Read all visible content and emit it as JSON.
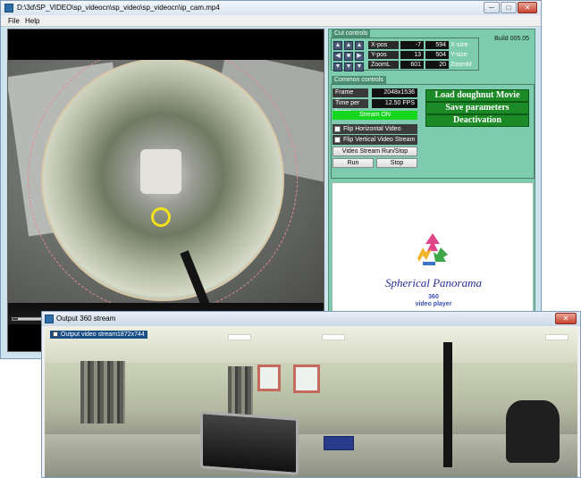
{
  "main_window": {
    "title": "D:\\3d\\SP_VIDEO\\sp_videocn\\sp_video\\sp_videocn\\ip_cam.mp4",
    "controls": {
      "minimize": "─",
      "maximize": "□",
      "close": "✕"
    },
    "menu": [
      "File",
      "Help"
    ]
  },
  "build": "Build 005.05",
  "cut_controls": {
    "title": "Cut controls",
    "rows": [
      {
        "label": "X-pos",
        "value": "-7",
        "value2": "594",
        "unit": "X-size"
      },
      {
        "label": "Y-pos",
        "value": "13",
        "value2": "504",
        "unit": "Y-size"
      },
      {
        "label": "ZoomL",
        "value": "601",
        "value2": "20",
        "unit": "ZoomM"
      }
    ]
  },
  "common_controls": {
    "title": "Common controls",
    "frame_size_label": "Frame Size:",
    "frame_size_value": "2048x1536",
    "time_per_frame_label": "Time per frame",
    "time_per_frame_value": "12.50 FPS",
    "stream_status": "Stream ON",
    "flip_horizontal": "Flip Horizontal Video Stream",
    "flip_vertical": "Flip Vertical Video Stream",
    "run_stop_label": "Video Stream Run/Stop",
    "run_button": "Run",
    "stop_button": "Stop"
  },
  "actions": {
    "load": "Load doughnut Movie",
    "save": "Save parameters",
    "deactivate": "Deactivation"
  },
  "logo": {
    "title": "Spherical Panorama",
    "number": "360",
    "subtitle": "video player"
  },
  "output_window": {
    "title": "Output 360 stream",
    "close": "✕",
    "label": "Output video stream1872x744"
  },
  "colors": {
    "panel_bg": "#7eccaf",
    "stream_on": "#16d61d",
    "action_button": "#1c8a26"
  }
}
